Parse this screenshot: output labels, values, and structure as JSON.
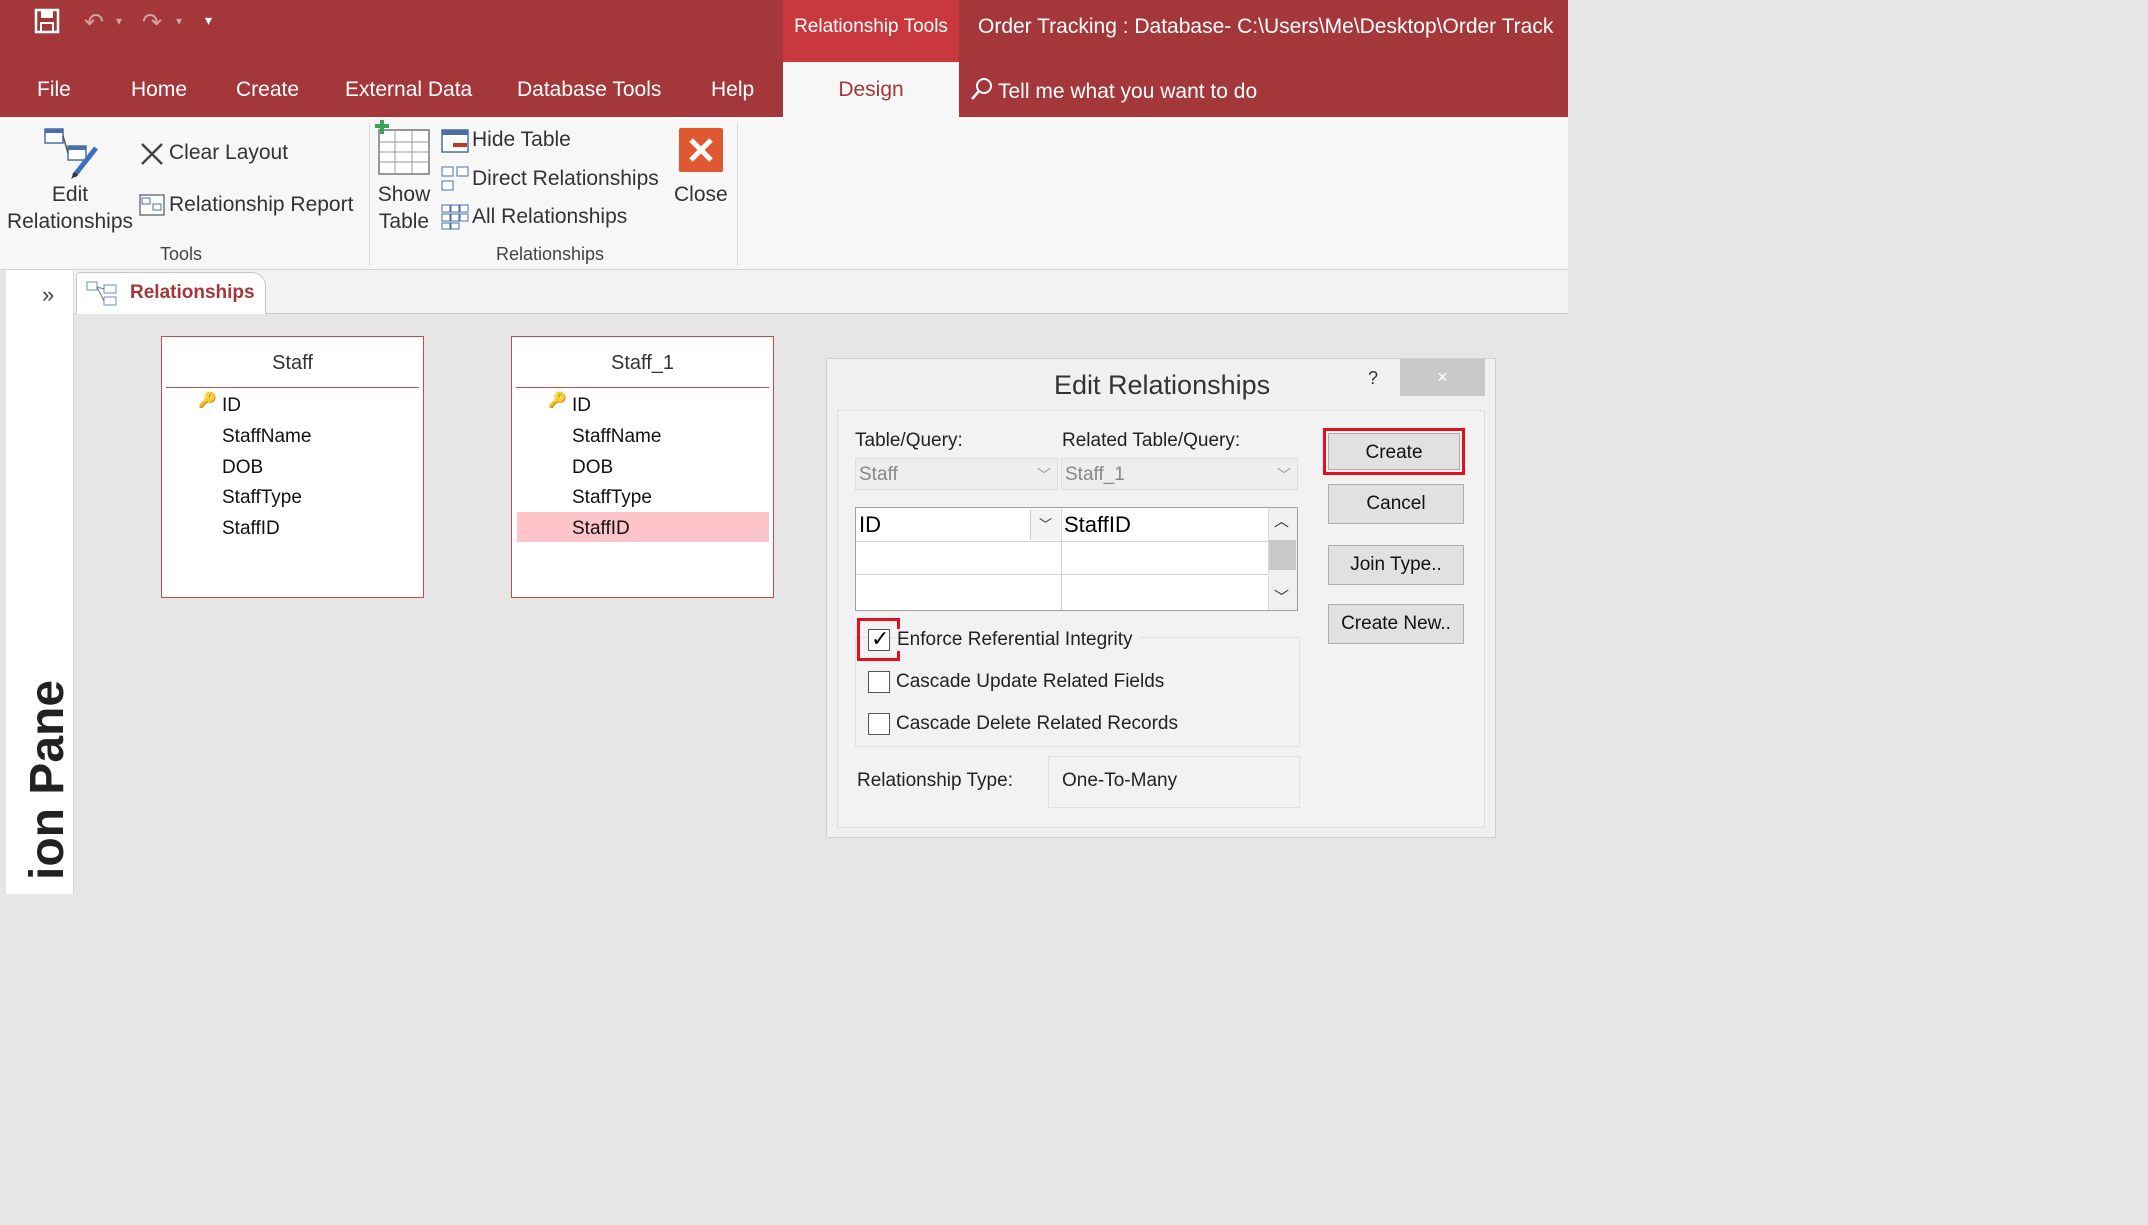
{
  "titlebar": {
    "contextual_tab_group": "Relationship Tools",
    "document_title": "Order Tracking : Database- C:\\Users\\Me\\Desktop\\Order Track",
    "tell_me": "Tell me what you want to do"
  },
  "tabs": [
    "File",
    "Home",
    "Create",
    "External Data",
    "Database Tools",
    "Help",
    "Design"
  ],
  "ribbon": {
    "tools": {
      "edit_relationships_line1": "Edit",
      "edit_relationships_line2": "Relationships",
      "clear_layout": "Clear Layout",
      "relationship_report": "Relationship Report",
      "group_label": "Tools"
    },
    "relationships": {
      "show_table_line1": "Show",
      "show_table_line2": "Table",
      "hide_table": "Hide Table",
      "direct_relationships": "Direct Relationships",
      "all_relationships": "All Relationships",
      "close": "Close",
      "group_label": "Relationships"
    }
  },
  "nav_pane": {
    "label": "ion Pane",
    "toggle": "»"
  },
  "document_tab": {
    "label": "Relationships"
  },
  "tables": [
    {
      "name": "Staff",
      "key_field": "ID",
      "fields": [
        "StaffName",
        "DOB",
        "StaffType",
        "StaffID"
      ]
    },
    {
      "name": "Staff_1",
      "key_field": "ID",
      "fields": [
        "StaffName",
        "DOB",
        "StaffType",
        "StaffID"
      ],
      "selected_field": "StaffID"
    }
  ],
  "dialog": {
    "title": "Edit Relationships",
    "help": "?",
    "close": "×",
    "table_query_label": "Table/Query:",
    "related_table_query_label": "Related Table/Query:",
    "table_query_value": "Staff",
    "related_table_query_value": "Staff_1",
    "grid": {
      "left_field": "ID",
      "right_field": "StaffID"
    },
    "enforce_referential_integrity": {
      "label": "Enforce Referential Integrity",
      "checked": true
    },
    "cascade_update": {
      "label": "Cascade Update Related Fields",
      "checked": false
    },
    "cascade_delete": {
      "label": "Cascade Delete Related Records",
      "checked": false
    },
    "relationship_type_label": "Relationship Type:",
    "relationship_type_value": "One-To-Many",
    "buttons": {
      "create": "Create",
      "cancel": "Cancel",
      "join_type": "Join Type..",
      "create_new": "Create New.."
    }
  },
  "colors": {
    "accent": "#a4373a",
    "highlight": "#e0101e",
    "selected_row": "#fdc5ca"
  }
}
